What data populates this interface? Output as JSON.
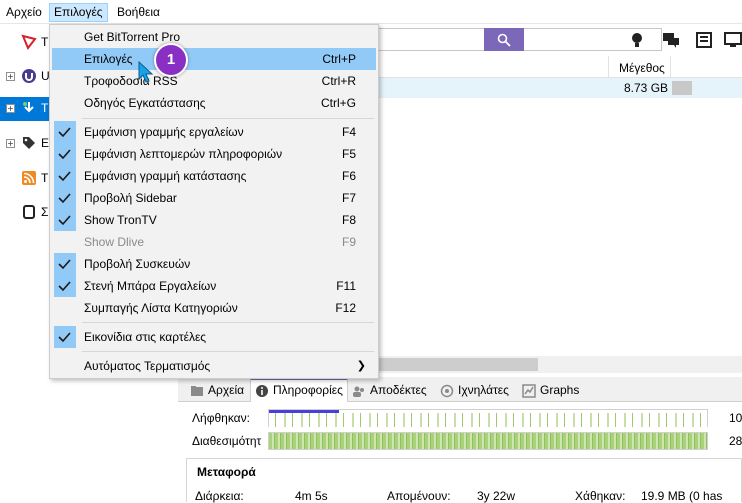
{
  "menubar": {
    "items": [
      "Αρχείο",
      "Επιλογές",
      "Βοήθεια"
    ]
  },
  "sidebar": {
    "items": [
      {
        "label": "T",
        "icon": "tron-icon"
      },
      {
        "label": "U",
        "icon": "utorrent-icon"
      },
      {
        "label": "T",
        "icon": "torrents-icon"
      },
      {
        "label": "E",
        "icon": "tag-icon"
      },
      {
        "label": "T",
        "icon": "rss-icon"
      },
      {
        "label": "Σ",
        "icon": "device-icon"
      }
    ]
  },
  "list": {
    "size_header": "Μέγεθος",
    "row_size": "8.73 GB"
  },
  "menu": {
    "items": [
      {
        "label": "Get BitTorrent Pro",
        "shortcut": "",
        "checked": false
      },
      {
        "label": "Επιλογές",
        "shortcut": "Ctrl+P",
        "checked": false,
        "highlighted": true
      },
      {
        "label": "Τροφοδοσία RSS",
        "shortcut": "Ctrl+R",
        "checked": false
      },
      {
        "label": "Οδηγός Εγκατάστασης",
        "shortcut": "Ctrl+G",
        "checked": false
      },
      {
        "label": "Εμφάνιση γραμμής εργαλείων",
        "shortcut": "F4",
        "checked": true
      },
      {
        "label": "Εμφάνιση λεπτομερών πληροφοριών",
        "shortcut": "F5",
        "checked": true
      },
      {
        "label": "Εμφάνιση  γραμμή κατάστασης",
        "shortcut": "F6",
        "checked": true
      },
      {
        "label": "Προβολή Sidebar",
        "shortcut": "F7",
        "checked": true
      },
      {
        "label": "Show TronTV",
        "shortcut": "F8",
        "checked": true
      },
      {
        "label": "Show Dlive",
        "shortcut": "F9",
        "checked": false,
        "disabled": true
      },
      {
        "label": "Προβολή Συσκευών",
        "shortcut": "",
        "checked": true
      },
      {
        "label": "Στενή Μπάρα Εργαλείων",
        "shortcut": "F11",
        "checked": true
      },
      {
        "label": "Συμπαγής Λίστα Κατηγοριών",
        "shortcut": "F12",
        "checked": false
      },
      {
        "label": "Εικονίδια στις καρτέλες",
        "shortcut": "",
        "checked": true
      },
      {
        "label": "Αυτόματος Τερματισμός",
        "shortcut": "",
        "checked": false,
        "submenu": true
      }
    ]
  },
  "step_badge": "1",
  "details": {
    "tabs": [
      "Αρχεία",
      "Πληροφορίες",
      "Αποδέκτες",
      "Ιχνηλάτες",
      "Graphs"
    ],
    "downloaded_label": "Λήφθηκαν:",
    "downloaded_value": "10",
    "availability_label": "Διαθεσιμότητ",
    "availability_value": "28",
    "transfer_title": "Μεταφορά",
    "duration_label": "Διάρκεια:",
    "duration_value": "4m 5s",
    "remaining_label": "Απομένουν:",
    "remaining_value": "3y 22w",
    "wasted_label": "Χάθηκαν:",
    "wasted_value": "19.9 MB (0 has"
  },
  "colors": {
    "accent": "#7b68b8",
    "menu_highlight": "#91c9f7",
    "badge": "#8a2fc4",
    "selection": "#0078d7"
  }
}
